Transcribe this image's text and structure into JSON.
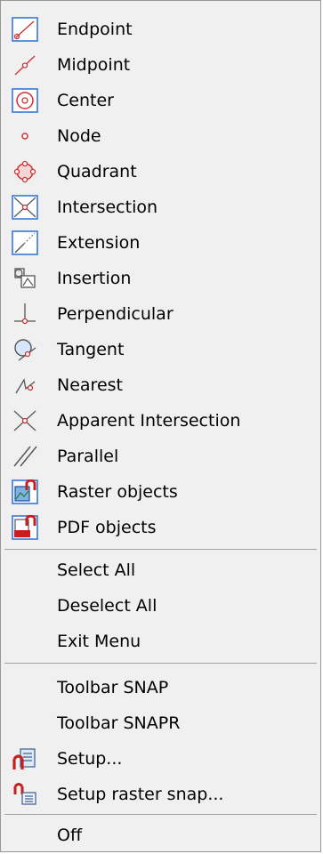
{
  "menu": {
    "snaps": [
      {
        "label": "Endpoint",
        "icon": "endpoint-icon"
      },
      {
        "label": "Midpoint",
        "icon": "midpoint-icon"
      },
      {
        "label": "Center",
        "icon": "center-icon"
      },
      {
        "label": "Node",
        "icon": "node-icon"
      },
      {
        "label": "Quadrant",
        "icon": "quadrant-icon"
      },
      {
        "label": "Intersection",
        "icon": "intersection-icon"
      },
      {
        "label": "Extension",
        "icon": "extension-icon"
      },
      {
        "label": "Insertion",
        "icon": "insertion-icon"
      },
      {
        "label": "Perpendicular",
        "icon": "perpendicular-icon"
      },
      {
        "label": "Tangent",
        "icon": "tangent-icon"
      },
      {
        "label": "Nearest",
        "icon": "nearest-icon"
      },
      {
        "label": "Apparent Intersection",
        "icon": "apparent-intersection-icon"
      },
      {
        "label": "Parallel",
        "icon": "parallel-icon"
      },
      {
        "label": "Raster objects",
        "icon": "raster-objects-icon"
      },
      {
        "label": "PDF objects",
        "icon": "pdf-objects-icon"
      }
    ],
    "selection": [
      {
        "label": "Select All"
      },
      {
        "label": "Deselect All"
      },
      {
        "label": "Exit Menu"
      }
    ],
    "tools": [
      {
        "label": "Toolbar SNAP"
      },
      {
        "label": "Toolbar SNAPR"
      },
      {
        "label": "Setup...",
        "icon": "setup-icon"
      },
      {
        "label": "Setup raster snap...",
        "icon": "setup-raster-snap-icon"
      }
    ],
    "off": {
      "label": "Off"
    }
  },
  "colors": {
    "snap_red": "#d03030",
    "icon_frame": "#2a6fd6",
    "menu_bg": "#f0f0f0",
    "separator": "#a0a0a0"
  }
}
